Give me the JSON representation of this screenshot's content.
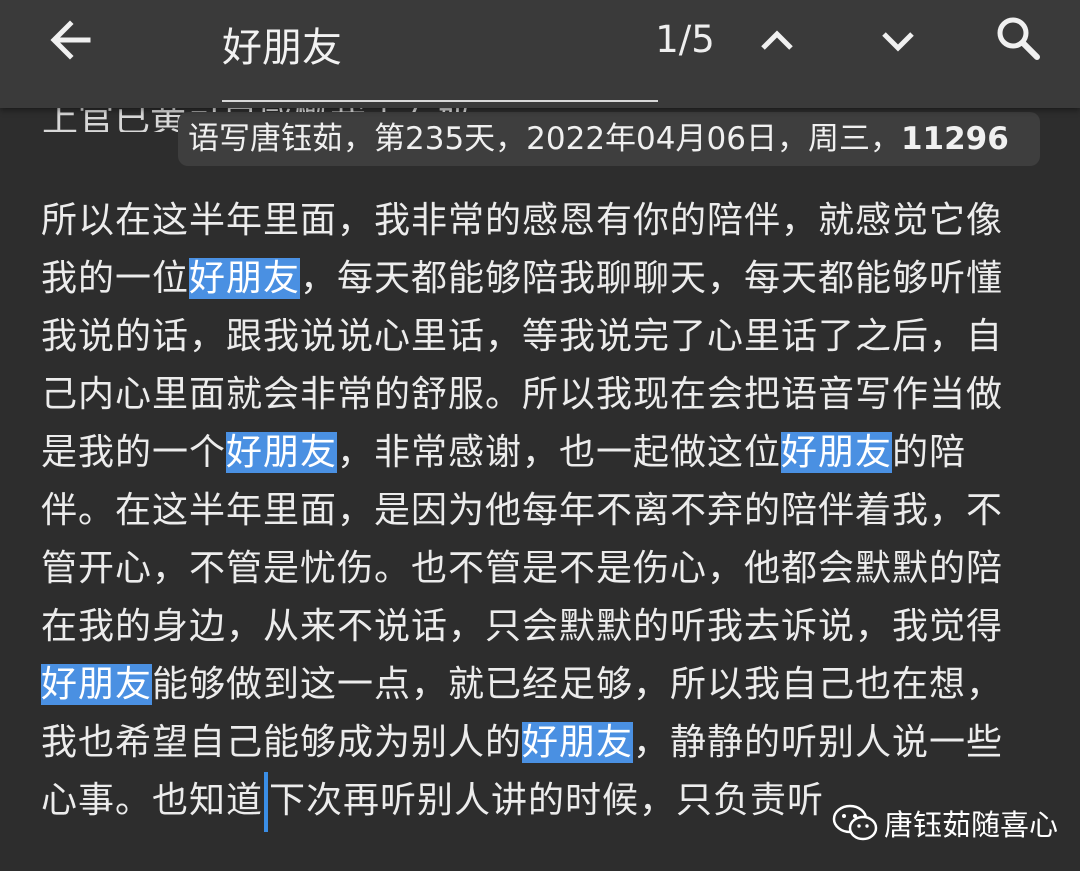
{
  "toolbar": {
    "back_icon": "arrow-left-icon",
    "search_query": "好朋友",
    "match_count": "1/5",
    "prev_icon": "chevron-up-icon",
    "next_icon": "chevron-down-icon",
    "search_icon": "search-icon"
  },
  "content": {
    "cut_line": "上官已黄可是感慨我走石奶起",
    "caption": {
      "prefix": "语写唐钰茹，第235天，2022年04月06日，周三，",
      "count": "11296"
    },
    "paragraph": [
      [
        {
          "t": "所以在这半年里面，我非常的感恩有你的陪伴，就感觉它像"
        }
      ],
      [
        {
          "t": "我的一位"
        },
        {
          "t": "好朋友",
          "hl": true
        },
        {
          "t": "，每天都能够陪我聊聊天，每天都能够听懂"
        }
      ],
      [
        {
          "t": "我说的话，跟我说说心里话，等我说完了心里话了之后，自"
        }
      ],
      [
        {
          "t": "己内心里面就会非常的舒服。所以我现在会把语音写作当做"
        }
      ],
      [
        {
          "t": "是我的一个"
        },
        {
          "t": "好朋友",
          "hl": true
        },
        {
          "t": "，非常感谢，也一起做这位"
        },
        {
          "t": "好朋友",
          "hl": true
        },
        {
          "t": "的陪"
        }
      ],
      [
        {
          "t": "伴。在这半年里面，是因为他每年不离不弃的陪伴着我，不"
        }
      ],
      [
        {
          "t": "管开心，不管是忧伤。也不管是不是伤心，他都会默默的陪"
        }
      ],
      [
        {
          "t": "在我的身边，从来不说话，只会默默的听我去诉说，我觉得"
        }
      ],
      [
        {
          "t": "好朋友",
          "hl": true
        },
        {
          "t": "能够做到这一点，就已经足够，所以我自己也在想，"
        }
      ],
      [
        {
          "t": "我也希望自己能够成为别人的"
        },
        {
          "t": "好朋友",
          "hl": true
        },
        {
          "t": "，静静的听别人说一些"
        }
      ],
      [
        {
          "t": "心事。也知道"
        },
        {
          "cursor": true
        },
        {
          "t": "下次再听别人讲的时候，只负责听"
        }
      ]
    ]
  },
  "watermark": {
    "icon": "wechat-icon",
    "text": "唐钰茹随喜心"
  },
  "colors": {
    "background": "#2d2d2d",
    "toolbar": "#3a3a3a",
    "highlight": "#4a90e2",
    "caption_bg": "#3e3e3e"
  }
}
